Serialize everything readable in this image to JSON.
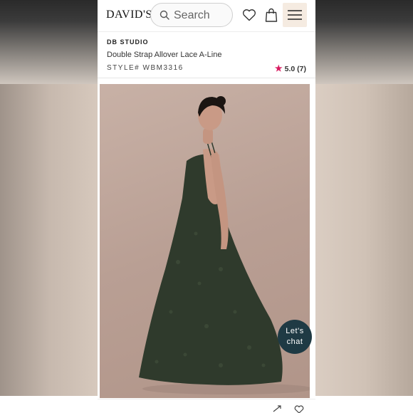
{
  "header": {
    "logo": "DAVID'S",
    "search_placeholder": "Search",
    "icons": [
      "search-icon",
      "heart-icon",
      "shopping-bag-icon",
      "hamburger-menu-icon"
    ]
  },
  "product": {
    "brand": "DB STUDIO",
    "name": "Double Strap Allover Lace A-Line",
    "style": "STYLE# WBM3316",
    "rating": "5.0 (7)",
    "rating_star_color": "#d81b60"
  },
  "chat": {
    "line1": "Let's",
    "line2": "chat"
  },
  "colors": {
    "dress": "#2f3a2c",
    "chat_bg": "#1f3a44",
    "menu_bg": "#f5ebe1"
  }
}
